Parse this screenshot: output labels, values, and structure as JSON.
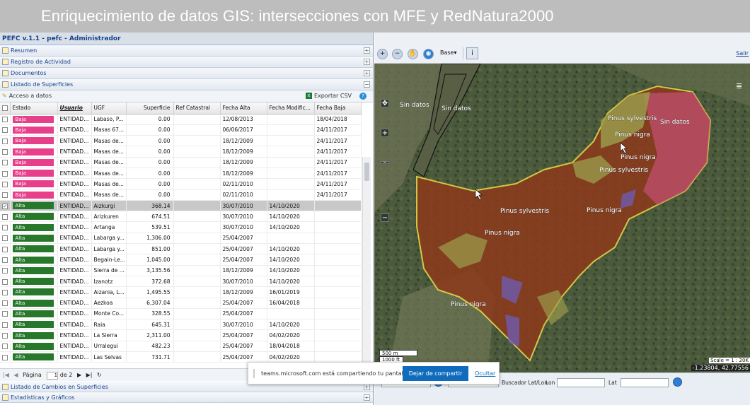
{
  "banner": "Enriquecimiento de datos GIS: intersecciones con MFE y RedNatura2000",
  "app_title": "PEFC v.1.1 - pefc - Administrador",
  "accordion": {
    "resumen": "Resumen",
    "registro": "Registro de Actividad",
    "documentos": "Documentos",
    "listado": "Listado de Superficies",
    "cambios": "Listado de Cambios en Superficies",
    "estadisticas": "Estadísticas y Gráficos"
  },
  "toolbar": {
    "acceso": "Acceso a datos",
    "exportar": "Exportar CSV"
  },
  "columns": [
    "Estado",
    "Usuario",
    "UGF",
    "Superficie",
    "Ref Catastral",
    "Fecha Alta",
    "Fecha Modific...",
    "Fecha Baja"
  ],
  "rows": [
    {
      "estado": "Baja",
      "usuario": "ENTIDAD...",
      "ugf": "Labaso, P...",
      "sup": "0.00",
      "ref": "",
      "alta": "12/08/2013",
      "mod": "",
      "baja": "18/04/2018",
      "checked": false
    },
    {
      "estado": "Baja",
      "usuario": "ENTIDAD...",
      "ugf": "Masas 67...",
      "sup": "0.00",
      "ref": "",
      "alta": "06/06/2017",
      "mod": "",
      "baja": "24/11/2017",
      "checked": false
    },
    {
      "estado": "Baja",
      "usuario": "ENTIDAD...",
      "ugf": "Masas de...",
      "sup": "0.00",
      "ref": "",
      "alta": "18/12/2009",
      "mod": "",
      "baja": "24/11/2017",
      "checked": false
    },
    {
      "estado": "Baja",
      "usuario": "ENTIDAD...",
      "ugf": "Masas de...",
      "sup": "0.00",
      "ref": "",
      "alta": "18/12/2009",
      "mod": "",
      "baja": "24/11/2017",
      "checked": false
    },
    {
      "estado": "Baja",
      "usuario": "ENTIDAD...",
      "ugf": "Masas de...",
      "sup": "0.00",
      "ref": "",
      "alta": "18/12/2009",
      "mod": "",
      "baja": "24/11/2017",
      "checked": false
    },
    {
      "estado": "Baja",
      "usuario": "ENTIDAD...",
      "ugf": "Masas de...",
      "sup": "0.00",
      "ref": "",
      "alta": "18/12/2009",
      "mod": "",
      "baja": "24/11/2017",
      "checked": false
    },
    {
      "estado": "Baja",
      "usuario": "ENTIDAD...",
      "ugf": "Masas de...",
      "sup": "0.00",
      "ref": "",
      "alta": "02/11/2010",
      "mod": "",
      "baja": "24/11/2017",
      "checked": false
    },
    {
      "estado": "Baja",
      "usuario": "ENTIDAD...",
      "ugf": "Masas de...",
      "sup": "0.00",
      "ref": "",
      "alta": "02/11/2010",
      "mod": "",
      "baja": "24/11/2017",
      "checked": false
    },
    {
      "estado": "Alta",
      "usuario": "ENTIDAD...",
      "ugf": "Aizkurgi",
      "sup": "368.14",
      "ref": "",
      "alta": "30/07/2010",
      "mod": "14/10/2020",
      "baja": "",
      "checked": true
    },
    {
      "estado": "Alta",
      "usuario": "ENTIDAD...",
      "ugf": "Arizkuren",
      "sup": "674.51",
      "ref": "",
      "alta": "30/07/2010",
      "mod": "14/10/2020",
      "baja": "",
      "checked": false
    },
    {
      "estado": "Alta",
      "usuario": "ENTIDAD...",
      "ugf": "Artanga",
      "sup": "539.51",
      "ref": "",
      "alta": "30/07/2010",
      "mod": "14/10/2020",
      "baja": "",
      "checked": false
    },
    {
      "estado": "Alta",
      "usuario": "ENTIDAD...",
      "ugf": "Labarga y...",
      "sup": "1,306.00",
      "ref": "",
      "alta": "25/04/2007",
      "mod": "",
      "baja": "",
      "checked": false
    },
    {
      "estado": "Alta",
      "usuario": "ENTIDAD...",
      "ugf": "Labarga y...",
      "sup": "851.00",
      "ref": "",
      "alta": "25/04/2007",
      "mod": "14/10/2020",
      "baja": "",
      "checked": false
    },
    {
      "estado": "Alta",
      "usuario": "ENTIDAD...",
      "ugf": "Begain-Le...",
      "sup": "1,045.00",
      "ref": "",
      "alta": "25/04/2007",
      "mod": "14/10/2020",
      "baja": "",
      "checked": false
    },
    {
      "estado": "Alta",
      "usuario": "ENTIDAD...",
      "ugf": "Sierra de ...",
      "sup": "3,135.56",
      "ref": "",
      "alta": "18/12/2009",
      "mod": "14/10/2020",
      "baja": "",
      "checked": false
    },
    {
      "estado": "Alta",
      "usuario": "ENTIDAD...",
      "ugf": "Izanotz",
      "sup": "372.68",
      "ref": "",
      "alta": "30/07/2010",
      "mod": "14/10/2020",
      "baja": "",
      "checked": false
    },
    {
      "estado": "Alta",
      "usuario": "ENTIDAD...",
      "ugf": "Aizania, L...",
      "sup": "1,495.55",
      "ref": "",
      "alta": "18/12/2009",
      "mod": "16/01/2019",
      "baja": "",
      "checked": false
    },
    {
      "estado": "Alta",
      "usuario": "ENTIDAD...",
      "ugf": "Aezkoa",
      "sup": "6,307.04",
      "ref": "",
      "alta": "25/04/2007",
      "mod": "16/04/2018",
      "baja": "",
      "checked": false
    },
    {
      "estado": "Alta",
      "usuario": "ENTIDAD...",
      "ugf": "Monte Co...",
      "sup": "328.55",
      "ref": "",
      "alta": "25/04/2007",
      "mod": "",
      "baja": "",
      "checked": false
    },
    {
      "estado": "Alta",
      "usuario": "ENTIDAD...",
      "ugf": "Raia",
      "sup": "645.31",
      "ref": "",
      "alta": "30/07/2010",
      "mod": "14/10/2020",
      "baja": "",
      "checked": false
    },
    {
      "estado": "Alta",
      "usuario": "ENTIDAD...",
      "ugf": "La Sierra",
      "sup": "2,311.00",
      "ref": "",
      "alta": "25/04/2007",
      "mod": "04/02/2020",
      "baja": "",
      "checked": false
    },
    {
      "estado": "Alta",
      "usuario": "ENTIDAD...",
      "ugf": "Urralegui",
      "sup": "482.23",
      "ref": "",
      "alta": "25/04/2007",
      "mod": "18/04/2018",
      "baja": "",
      "checked": false
    },
    {
      "estado": "Alta",
      "usuario": "ENTIDAD...",
      "ugf": "Las Selvas",
      "sup": "731.71",
      "ref": "",
      "alta": "25/04/2007",
      "mod": "04/02/2020",
      "baja": "",
      "checked": false
    }
  ],
  "pager": {
    "pagina": "Página",
    "page": "1",
    "of": "de 2"
  },
  "colors": {
    "baja": "#e83f8b",
    "alta": "#27782b",
    "forest": "#8b3a1c",
    "border": "#e4d84a"
  },
  "map_toolbar": {
    "base": "Base",
    "salir": "Salir"
  },
  "map_labels": [
    "Sin datos",
    "Sin datos",
    "Pinus sylvestris",
    "Sin datos",
    "Pinus nigra",
    "Pinus nigra",
    "Pinus sylvestris",
    "Pinus sylvestris",
    "Pinus nigra",
    "Pinus nigra",
    "Pinus nigra"
  ],
  "scale": {
    "m": "500 m",
    "ft": "1000 ft",
    "scale_label": "Scale = 1 : 20K",
    "coords": "-1.23804, 42.77556"
  },
  "map_footer": {
    "field1": "1",
    "scale_value": "1 : 20000",
    "buscador": "Buscador Lat/Lon",
    "lon": "Lon",
    "lat": "Lat"
  },
  "share": {
    "message": "teams.microsoft.com está compartiendo tu pantalla.",
    "stop": "Dejar de compartir",
    "hide": "Ocultar"
  }
}
